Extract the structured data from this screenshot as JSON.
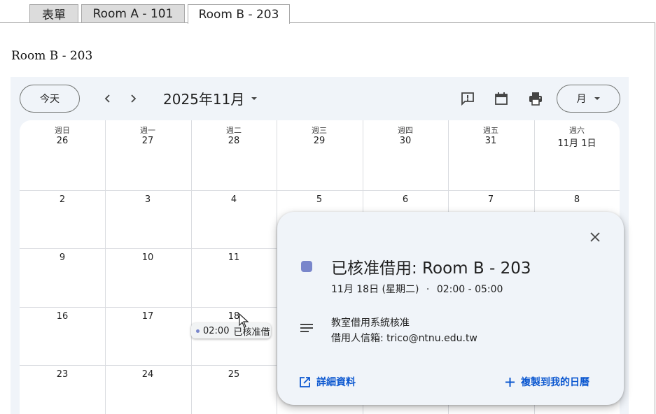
{
  "tabs": [
    {
      "label": "表單",
      "active": false
    },
    {
      "label": "Room A - 101",
      "active": false
    },
    {
      "label": "Room B - 203",
      "active": true
    }
  ],
  "page_heading": "Room B - 203",
  "calendar": {
    "today_label": "今天",
    "month_title": "2025年11月",
    "view_label": "月",
    "icons": [
      "feedback-icon",
      "calendar-icon",
      "print-icon"
    ],
    "weekdays": [
      "週日",
      "週一",
      "週二",
      "週三",
      "週四",
      "週五",
      "週六"
    ],
    "weeks": [
      [
        "26",
        "27",
        "28",
        "29",
        "30",
        "31",
        "11月 1日"
      ],
      [
        "2",
        "3",
        "4",
        "5",
        "6",
        "7",
        "8"
      ],
      [
        "9",
        "10",
        "11",
        "",
        "",
        "",
        ""
      ],
      [
        "16",
        "17",
        "18",
        "",
        "",
        "",
        ""
      ],
      [
        "23",
        "24",
        "25",
        "",
        "",
        "",
        ""
      ]
    ],
    "event_chip": {
      "time": "02:00",
      "title": "已核准借"
    },
    "accent_color": "#7986cb"
  },
  "popup": {
    "title": "已核准借用: Room B - 203",
    "date": "11月 18日 (星期二)",
    "separator": "·",
    "time_range": "02:00 - 05:00",
    "description_line1": "教室借用系統核准",
    "description_line2": "借用人信箱: trico@ntnu.edu.tw",
    "details_label": "詳細資料",
    "copy_label": "複製到我的日曆",
    "link_color": "#0b57d0"
  }
}
